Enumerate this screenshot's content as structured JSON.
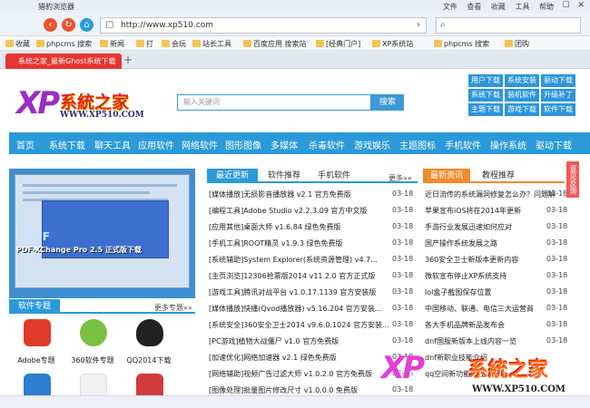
{
  "browser": {
    "title": "猎豹浏览器",
    "logo_text": "orange",
    "top_menu": [
      "文件",
      "查看",
      "收藏",
      "工具",
      "帮助"
    ],
    "window_controls": "— ☐ ✕",
    "address": "http://www.xp510.com",
    "favorites": [
      "收藏",
      "phpcms 搜索",
      "新闻",
      "打",
      "会玩",
      "站长工具",
      "百度应用 搜索站",
      "[经典门户]",
      "XP系统站",
      "phpcms 搜索",
      "团购"
    ],
    "tab_title": "系统之家_最新Ghost系统下载",
    "new_tab": "+"
  },
  "site": {
    "logo_xp": "XP",
    "brand": "系統之家",
    "brand_url": "WWW.XP510.COM",
    "search_placeholder": "输入关键词",
    "search_btn": "搜索",
    "quick_links": [
      "用户下载",
      "系统安装",
      "驱动下载",
      "系统下载",
      "装机软件",
      "升级补丁",
      "主题下载",
      "游戏下载",
      "软件下载"
    ],
    "nav": [
      "首页",
      "系统下载",
      "聊天工具",
      "应用软件",
      "网络软件",
      "图形图像",
      "多媒体",
      "杀毒软件",
      "游戏娱乐",
      "主题图标",
      "手机软件",
      "操作系统",
      "驱动下载"
    ],
    "hero_caption": "PDF-XChange Pro 2.5 正式版下载",
    "hero_title": "PDF",
    "soft_topic": "软件专题",
    "more_topics": "更多专题»»",
    "categories": [
      {
        "label": "Adobe专题",
        "color": "#e03a2b"
      },
      {
        "label": "360软件专题",
        "color": "#7ac143"
      },
      {
        "label": "QQ2014下载",
        "color": "#222222"
      }
    ],
    "center_tabs": [
      "最近更新",
      "软件推荐",
      "手机软件"
    ],
    "more": "更多»»",
    "news": [
      {
        "t": "[媒体播放]无损影音播放器 v2.1 官方免费版",
        "d": "03-18"
      },
      {
        "t": "[编程工具]Adobe Studio v2.2.3.09 官方中文版",
        "d": "03-18"
      },
      {
        "t": "[应用其他]桌面大师 v1.6.84 绿色免费版",
        "d": "03-18"
      },
      {
        "t": "[手机工具]ROOT精灵 v1.9.3 绿色免费版",
        "d": "03-18"
      },
      {
        "t": "[系统辅助]System Explorer(系统资源管理) v4.7...",
        "d": "03-18"
      },
      {
        "t": "[主页浏览]12306抢票版2014 v11.2.0 官方正式版",
        "d": "03-18"
      },
      {
        "t": "[游戏工具]腾讯对战平台 v1.0.17.1139 官方安装版",
        "d": "03-18"
      },
      {
        "t": "[媒体播放]快播(Qvod播放器) v5.16.204 官方安装...",
        "d": "03-18"
      },
      {
        "t": "[系统安全]360安全卫士2014 v9.6.0.1024 官方安装...",
        "d": "03-18"
      },
      {
        "t": "[PC游戏]植物大战僵尸 v1.0 官方免费版",
        "d": "03-18"
      },
      {
        "t": "[加速优化]网络加速器 v2.1 绿色免费版",
        "d": "03-18"
      },
      {
        "t": "[网络辅助]视频广告过滤大师 v1.0.2.0 官方免费版",
        "d": "03-18"
      },
      {
        "t": "[图像处理]批量图片修改尺寸 v1.0.0.0 免费版",
        "d": "03-18"
      }
    ],
    "right_tabs": [
      "最新资讯",
      "教程推荐"
    ],
    "right_news": [
      {
        "t": "近日流传的系统漏洞修复怎么办？问题解",
        "d": "03-18"
      },
      {
        "t": "苹果宣布iOS将在2014年更新",
        "d": "03-18"
      },
      {
        "t": "手游行业发展迅速如何应对",
        "d": "03-18"
      },
      {
        "t": "国产操作系统发展之路",
        "d": "03-18"
      },
      {
        "t": "360安全卫士新版本更新内容",
        "d": "03-18"
      },
      {
        "t": "微软宣布停止XP系统支持",
        "d": "03-18"
      },
      {
        "t": "lol盒子截图保存位置",
        "d": "03-18"
      },
      {
        "t": "中国移动、联通、电信三大运营商",
        "d": "03-18"
      },
      {
        "t": "各大手机品牌新品发布会",
        "d": "03-18"
      },
      {
        "t": "dnf国服新版本上线内容一览",
        "d": "03-18"
      },
      {
        "t": "dnf新职业技能介绍",
        "d": "03-18"
      },
      {
        "t": "qq空间新功能上线",
        "d": "03-18"
      }
    ],
    "side_tab": "意见反馈",
    "watermark_url": "WWW.XP510.COM"
  }
}
